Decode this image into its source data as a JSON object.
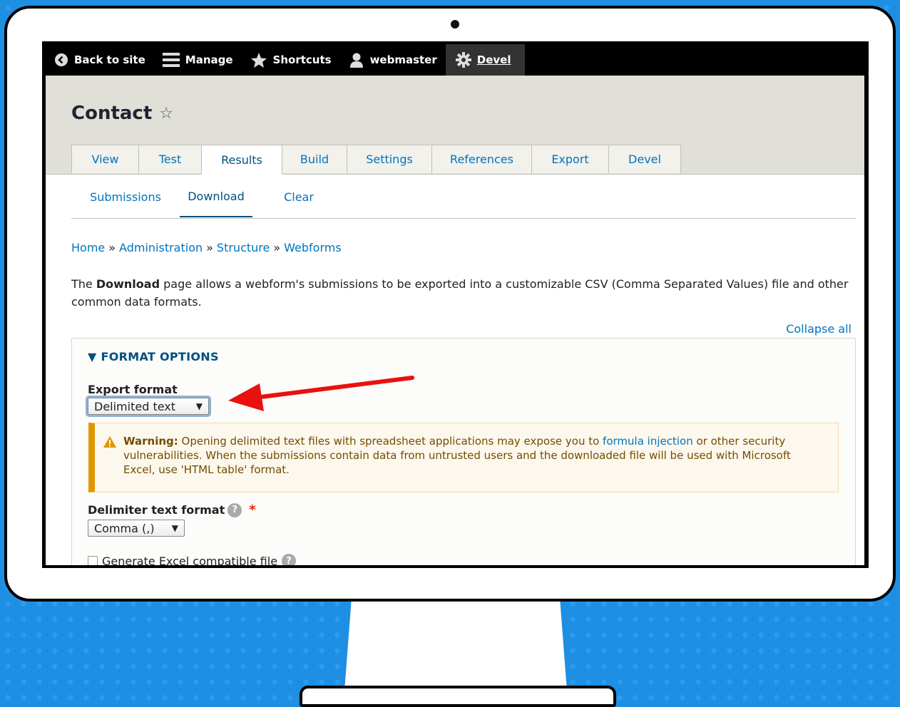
{
  "toolbar": {
    "back": "Back to site",
    "manage": "Manage",
    "shortcuts": "Shortcuts",
    "user": "webmaster",
    "devel": "Devel"
  },
  "page": {
    "title": "Contact"
  },
  "tabs": [
    "View",
    "Test",
    "Results",
    "Build",
    "Settings",
    "References",
    "Export",
    "Devel"
  ],
  "active_tab": "Results",
  "subtabs": [
    "Submissions",
    "Download",
    "Clear"
  ],
  "active_subtab": "Download",
  "breadcrumb": [
    "Home",
    "Administration",
    "Structure",
    "Webforms"
  ],
  "breadcrumb_sep": "»",
  "description": {
    "pre": "The ",
    "bold": "Download",
    "post": " page allows a webform's submissions to be exported into a customizable CSV (Comma Separated Values) file and other common data formats."
  },
  "collapse_all": "Collapse all",
  "format_options": {
    "legend": "▼ FORMAT OPTIONS",
    "export_format_label": "Export format",
    "export_format_value": "Delimited text",
    "warning": {
      "title": "Warning:",
      "text1": " Opening delimited text files with spreadsheet applications may expose you to ",
      "link": "formula injection",
      "text2": " or other security vulnerabilities. When the submissions contain data from untrusted users and the downloaded file will be used with Microsoft Excel, use 'HTML table' format."
    },
    "delimiter_label": "Delimiter text format",
    "delimiter_value": "Comma (,)",
    "required_mark": "*",
    "excel_checkbox_label": "Generate Excel compatible file",
    "help": "?"
  },
  "colors": {
    "link": "#0074bd",
    "warning_border": "#e09600",
    "annotation_arrow": "#e8110f"
  }
}
